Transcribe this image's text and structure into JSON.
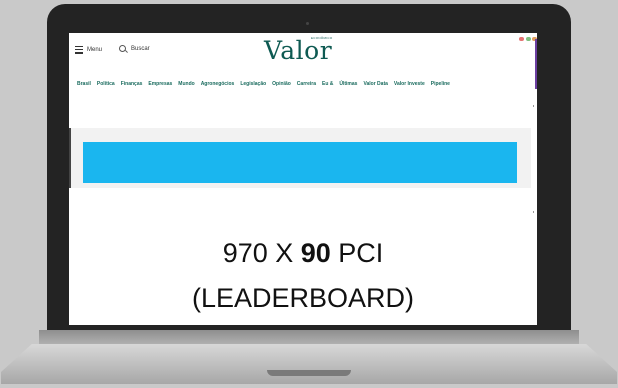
{
  "header": {
    "menu_label": "Menu",
    "search_label": "Buscar",
    "logo_text": "Valor",
    "logo_sup": "ECONÔMICO"
  },
  "nav": {
    "items": [
      "Brasil",
      "Política",
      "Finanças",
      "Empresas",
      "Mundo",
      "Agronegócios",
      "Legislação",
      "Opinião",
      "Carreira",
      "Eu &",
      "Últimas",
      "Valor Data",
      "Valor Investe",
      "Pipeline"
    ]
  },
  "ad": {
    "size_prefix": "970 X ",
    "size_bold": "90",
    "size_suffix": " PCI",
    "type_label": "(LEADERBOARD)",
    "placeholder_color": "#1ab6ef"
  },
  "colors": {
    "brand": "#0e5a52",
    "nav_text": "#1a6b5e",
    "sidebar_accent": "#6b3fa0"
  }
}
